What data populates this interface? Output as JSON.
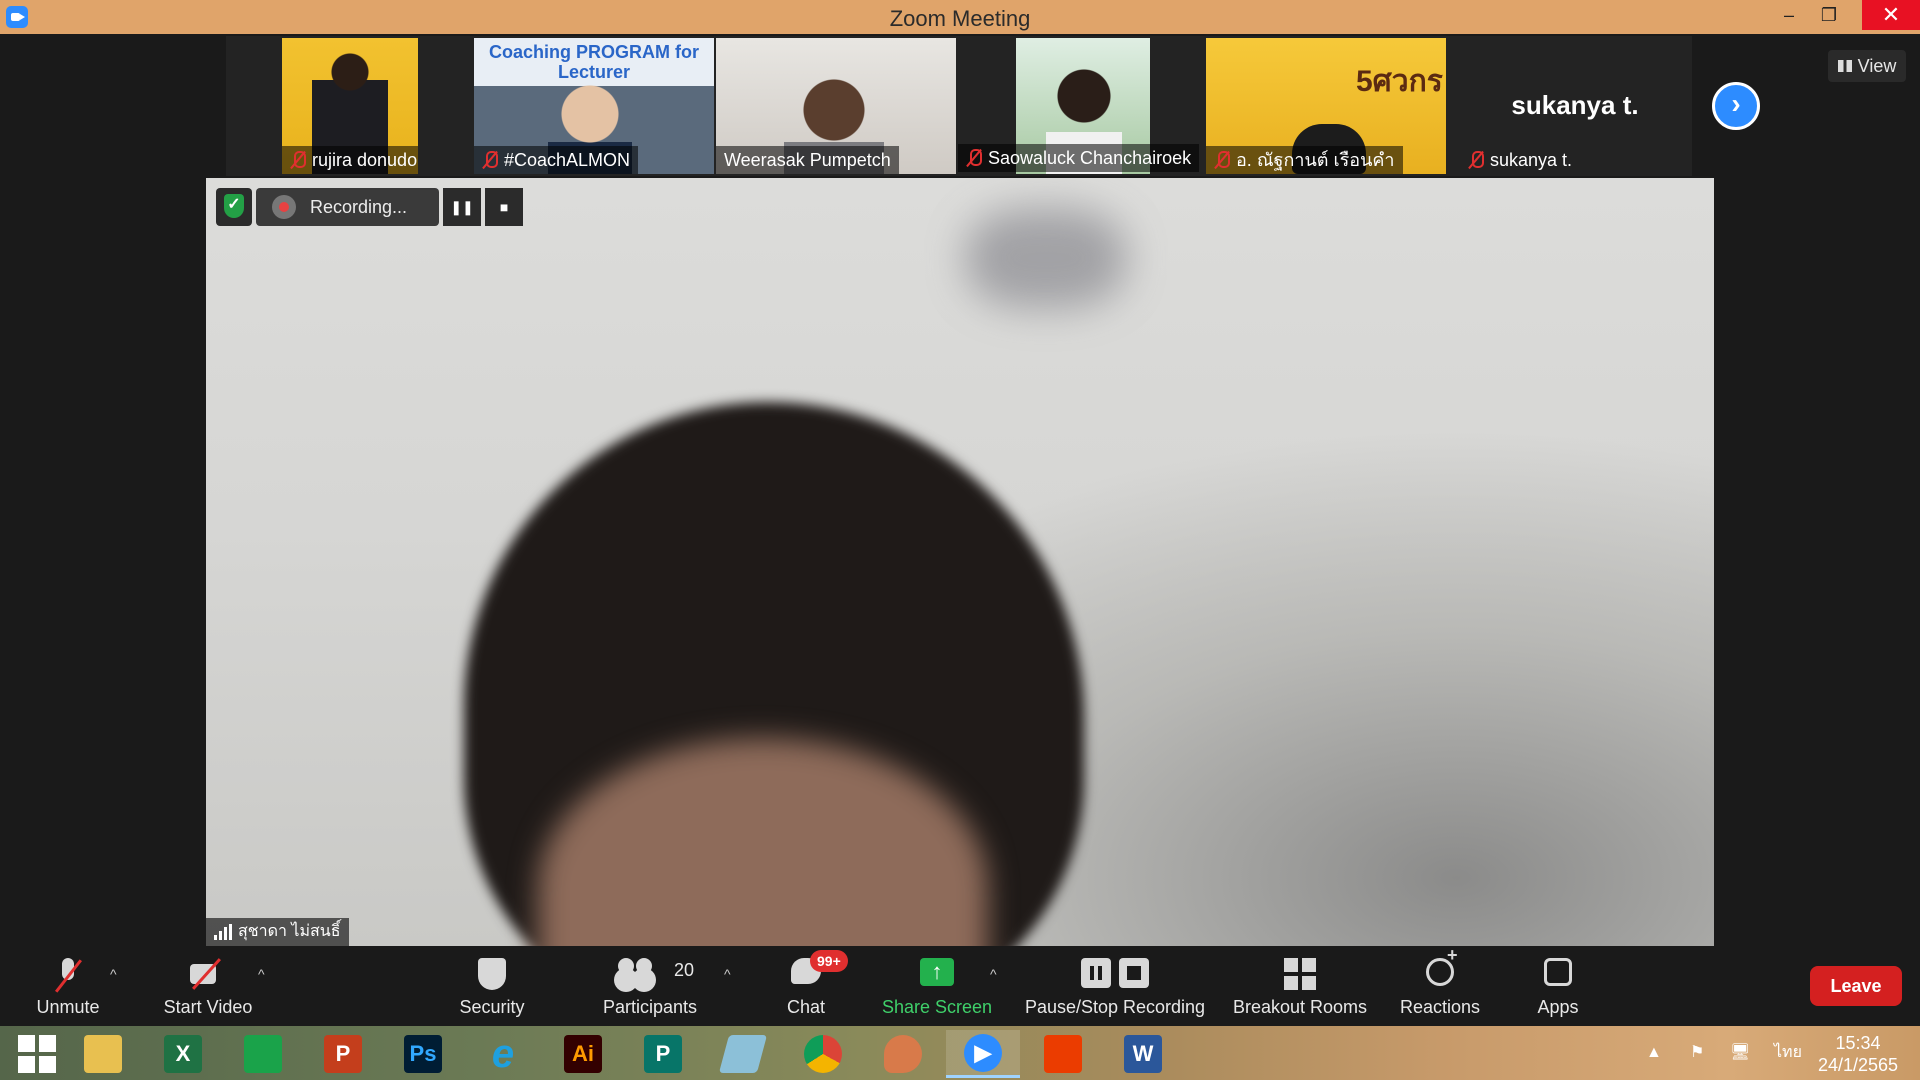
{
  "window": {
    "title": "Zoom Meeting",
    "minimize": "–",
    "maximize": "❐",
    "close": "✕"
  },
  "gallery": {
    "participants": [
      {
        "name": "rujira donudom",
        "muted": true
      },
      {
        "name": "#CoachALMON",
        "muted": true
      },
      {
        "name": "Weerasak Pumpetch",
        "muted": false
      },
      {
        "name": "Saowaluck Chanchairoek",
        "muted": true
      },
      {
        "name": "อ. ณัฐกานต์  เรือนคำ",
        "muted": true
      },
      {
        "name": "sukanya t.",
        "muted": true
      }
    ],
    "coach_banner": "Coaching PROGRAM for Lecturer",
    "t5_logo_text": "5ศวกร",
    "no_video_name": "sukanya t.",
    "next_icon": "chevron-right-icon",
    "view_label": "View"
  },
  "speaker": {
    "recording_label": "Recording...",
    "name": "สุชาดา ไม่สนธิ์"
  },
  "toolbar": {
    "unmute": "Unmute",
    "start_video": "Start Video",
    "security": "Security",
    "participants": "Participants",
    "participants_count": "20",
    "chat": "Chat",
    "chat_badge": "99+",
    "share_screen": "Share Screen",
    "share_arrow": "↑",
    "pause_stop_recording": "Pause/Stop Recording",
    "breakout_rooms": "Breakout Rooms",
    "reactions": "Reactions",
    "apps": "Apps",
    "leave": "Leave",
    "caret": "^"
  },
  "taskbar": {
    "apps": [
      {
        "name": "File Explorer"
      },
      {
        "name": "Excel",
        "letter": "X",
        "color": "#1f7244"
      },
      {
        "name": "Store",
        "letter": "",
        "color": "#1aa34a"
      },
      {
        "name": "PowerPoint",
        "letter": "P",
        "color": "#c43e1c"
      },
      {
        "name": "Photoshop",
        "letter": "Ps",
        "color": "#001d34"
      },
      {
        "name": "Internet Explorer",
        "letter": "e",
        "color": "#1ea0e0"
      },
      {
        "name": "Illustrator",
        "letter": "Ai",
        "color": "#330000"
      },
      {
        "name": "Publisher",
        "letter": "P",
        "color": "#077568"
      },
      {
        "name": "Pencil"
      },
      {
        "name": "Chrome"
      },
      {
        "name": "Paint"
      },
      {
        "name": "Zoom",
        "color": "#2d8cff"
      },
      {
        "name": "Office"
      },
      {
        "name": "Word",
        "letter": "W",
        "color": "#2b579a"
      }
    ],
    "language": "ไทย",
    "time": "15:34",
    "date": "24/1/2565",
    "tray_up": "▲"
  },
  "colors": {
    "title_bar": "#e0a46a",
    "zoom_blue": "#2d8cff",
    "leave_red": "#d42020",
    "share_green": "#23b14d"
  }
}
